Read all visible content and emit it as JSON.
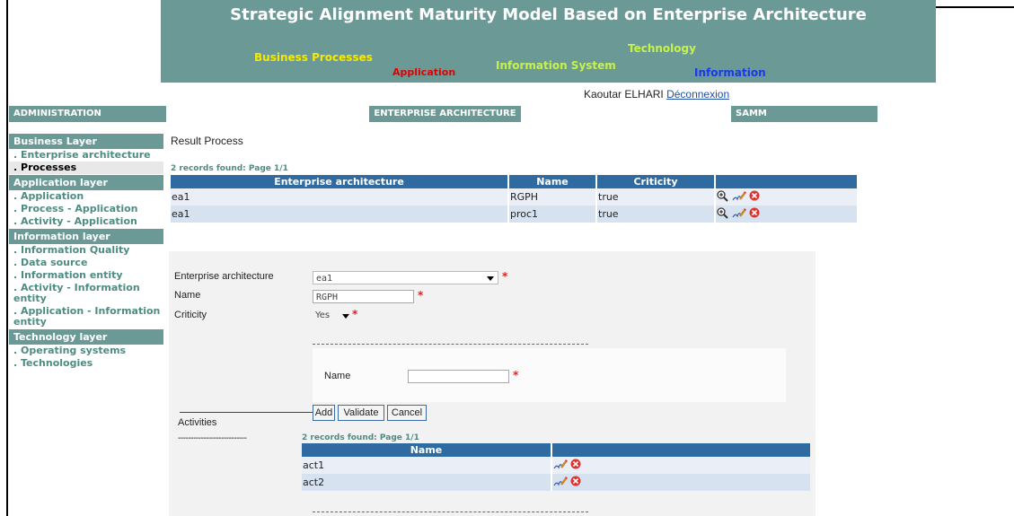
{
  "banner": {
    "title": "Strategic Alignment Maturity Model Based on Enterprise Architecture",
    "words": {
      "business_processes": "Business Processes",
      "application": "Application",
      "information_system": "Information System",
      "technology": "Technology",
      "information": "Information"
    },
    "colors": {
      "bg": "#6b9a96",
      "yellow": "#f5e900",
      "red": "#e00000",
      "green": "#c6f24a",
      "blue": "#1a39e8"
    }
  },
  "user": {
    "name": "Kaoutar ELHARI",
    "logout": "Déconnexion"
  },
  "tabs": {
    "administration": "ADMINISTRATION",
    "enterprise_architecture": "ENTERPRISE ARCHITECTURE",
    "samm": "SAMM"
  },
  "sidebar": {
    "business_layer": "Business Layer",
    "business_items": [
      ". Enterprise architecture",
      ". Processes"
    ],
    "application_layer": "Application layer",
    "application_items": [
      ". Application",
      ". Process - Application",
      ". Activity - Application"
    ],
    "information_layer": "Information layer",
    "information_items": [
      ". Information Quality",
      ". Data source",
      ". Information entity",
      ". Activity - Information entity",
      ". Application - Information entity"
    ],
    "technology_layer": "Technology layer",
    "technology_items": [
      ". Operating systems",
      ". Technologies"
    ]
  },
  "page": {
    "title": "Result Process",
    "records": "2 records found: Page 1/1"
  },
  "process_table": {
    "headers": [
      "Enterprise architecture",
      "Name",
      "Criticity",
      ""
    ],
    "rows": [
      {
        "ea": "ea1",
        "name": "RGPH",
        "criticity": "true"
      },
      {
        "ea": "ea1",
        "name": "proc1",
        "criticity": "true"
      }
    ]
  },
  "form": {
    "ea_label": "Enterprise architecture",
    "ea_value": "ea1",
    "name_label": "Name",
    "name_value": "RGPH",
    "criticity_label": "Criticity",
    "criticity_value": "Yes",
    "required_mark": "*",
    "activity_name_label": "Name",
    "activity_name_value": "",
    "buttons": {
      "add": "Add",
      "validate": "Validate",
      "cancel": "Cancel"
    },
    "activities_label": "Activities",
    "activities_dashes": "---------------------------"
  },
  "activities_table": {
    "records": "2 records found: Page 1/1",
    "headers": [
      "Name",
      ""
    ],
    "rows": [
      {
        "name": "act1"
      },
      {
        "name": "act2"
      }
    ]
  },
  "icons": {
    "view": "magnifier-plus-icon",
    "edit": "edit-pen-icon",
    "delete": "delete-icon"
  }
}
